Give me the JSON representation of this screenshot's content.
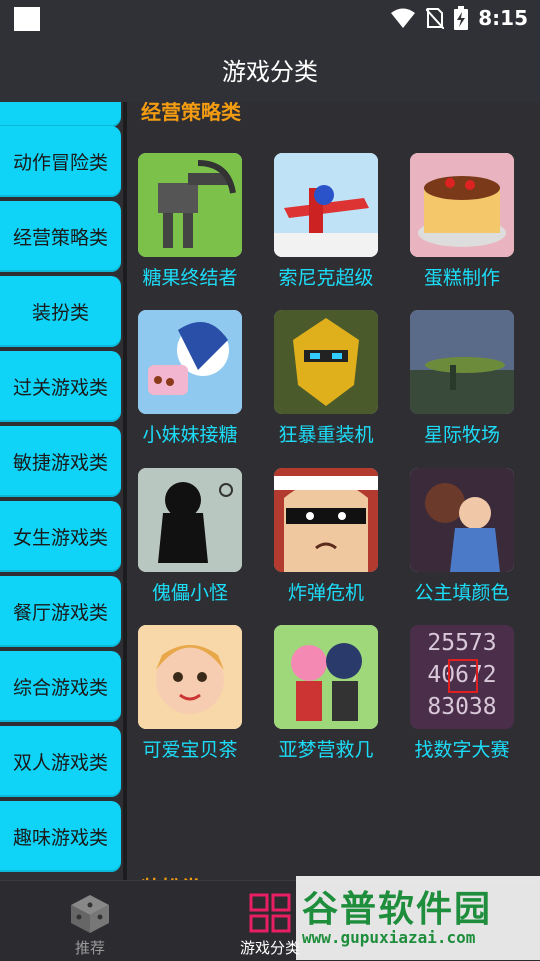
{
  "status_bar": {
    "time": "8:15"
  },
  "app_bar": {
    "title": "游戏分类"
  },
  "sidebar": {
    "items": [
      {
        "label": ""
      },
      {
        "label": "动作冒险类"
      },
      {
        "label": "经营策略类"
      },
      {
        "label": "装扮类"
      },
      {
        "label": "过关游戏类"
      },
      {
        "label": "敏捷游戏类"
      },
      {
        "label": "女生游戏类"
      },
      {
        "label": "餐厅游戏类"
      },
      {
        "label": "综合游戏类"
      },
      {
        "label": "双人游戏类"
      },
      {
        "label": "趣味游戏类"
      }
    ]
  },
  "main": {
    "section_title": "经营策略类",
    "next_section_title": "装扮类",
    "games": [
      {
        "name": "糖果终结者",
        "icon": "robot-mech-thumbnail"
      },
      {
        "name": "索尼克超级",
        "icon": "sonic-airplane-thumbnail"
      },
      {
        "name": "蛋糕制作",
        "icon": "cake-thumbnail"
      },
      {
        "name": "小妹妹接糖",
        "icon": "girl-candy-thumbnail"
      },
      {
        "name": "狂暴重装机",
        "icon": "yellow-robot-thumbnail"
      },
      {
        "name": "星际牧场",
        "icon": "space-ranch-thumbnail"
      },
      {
        "name": "傀儡小怪",
        "icon": "shadow-creature-thumbnail"
      },
      {
        "name": "炸弹危机",
        "icon": "masked-bandit-thumbnail"
      },
      {
        "name": "公主填颜色",
        "icon": "princess-beast-thumbnail"
      },
      {
        "name": "可爱宝贝茶",
        "icon": "baby-girl-thumbnail"
      },
      {
        "name": "亚梦营救几",
        "icon": "anime-couple-thumbnail"
      },
      {
        "name": "找数字大赛",
        "icon": "number-grid-thumbnail"
      }
    ],
    "number_grid": [
      "25573",
      "40672",
      "83038"
    ]
  },
  "bottom_nav": {
    "tabs": [
      {
        "label": "推荐",
        "icon": "dice-icon"
      },
      {
        "label": "游戏分类",
        "icon": "grid-icon"
      }
    ],
    "active_color": "#e91e63"
  },
  "watermark": {
    "text": "谷普软件园",
    "url": "www.gupuxiazai.com"
  },
  "colors": {
    "accent": "#0fd4f8",
    "section_title": "#f39c12",
    "label": "#1cdcf8"
  }
}
